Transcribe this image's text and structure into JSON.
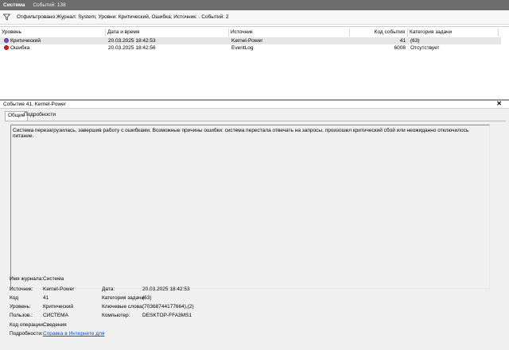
{
  "titlebar": {
    "title": "Система",
    "count": "Событий: 138"
  },
  "filter": {
    "text": "Отфильтровано:Журнал: System; Уровни: Критический, Ошибка; Источник: . Событий: 2"
  },
  "table": {
    "columns": {
      "level": "Уровень",
      "datetime": "Дата и время",
      "source": "Источник",
      "event_id": "Код события",
      "task": "Категория задачи"
    },
    "rows": [
      {
        "level": "Критический",
        "datetime": "20.03.2025 18:42:53",
        "source": "Kernel-Power",
        "event_id": "41",
        "task": "(63)"
      },
      {
        "level": "Ошибка",
        "datetime": "20.03.2025 18:42:56",
        "source": "EventLog",
        "event_id": "6008",
        "task": "Отсутствует"
      }
    ]
  },
  "details": {
    "header": "Событие 41, Kernel-Power",
    "tabs": {
      "general": "Общие",
      "details": "Подробности"
    },
    "message": "Система перезагрузилась, завершив работу с ошибками. Возможные причины ошибки: система перестала отвечать на запросы, произошел критический сбой или неожиданно отключилось питание.",
    "props": {
      "log_label": "Имя журнала:",
      "log_value": "Система",
      "source_label": "Источник:",
      "source_value": "Kernel-Power",
      "date_label": "Дата:",
      "date_value": "20.03.2025 18:42:53",
      "code_label": "Код",
      "code_value": "41",
      "task_label": "Категория задачи:",
      "task_value": "(63)",
      "level_label": "Уровень:",
      "level_value": "Критический",
      "keywords_label": "Ключевые слова:",
      "keywords_value": "(70368744177664),(2)",
      "user_label": "Пользов.:",
      "user_value": "СИСТЕМА",
      "computer_label": "Компьютер:",
      "computer_value": "DESKTOP-FFA3MS1",
      "opcode_label": "Код операции:",
      "opcode_value": "Сведения",
      "more_label": "Подробности:",
      "more_link": "Справка в Интернете для"
    }
  },
  "icons": {
    "filter": "filter-icon",
    "critical": "critical-icon",
    "error": "error-icon",
    "close": "close-icon"
  }
}
